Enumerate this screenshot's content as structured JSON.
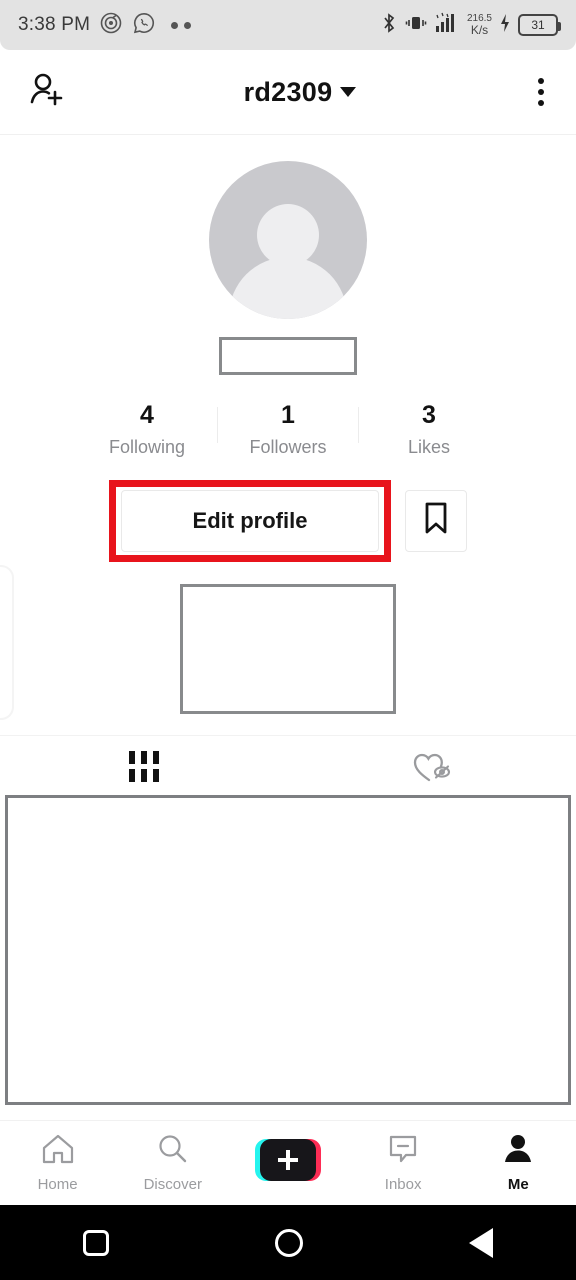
{
  "status_bar": {
    "time": "3:38 PM",
    "app_icons": [
      "music-app-icon",
      "whatsapp-icon",
      "more-notifications-dots"
    ],
    "bluetooth_icon": "bluetooth-icon",
    "vibrate_icon": "vibrate-icon",
    "signal_icon": "signal-bars-icon",
    "network_speed_value": "216.5",
    "network_speed_unit": "K/s",
    "charging_icon": "charging-bolt-icon",
    "battery_level": "31"
  },
  "header": {
    "add_friend_icon": "add-friend-icon",
    "username": "rd2309",
    "dropdown_icon": "chevron-down-icon",
    "menu_icon": "kebab-menu-icon"
  },
  "profile": {
    "avatar_icon": "default-avatar-icon",
    "username_redacted": "",
    "bio_redacted": "",
    "stats": [
      {
        "count": "4",
        "label": "Following"
      },
      {
        "count": "1",
        "label": "Followers"
      },
      {
        "count": "3",
        "label": "Likes"
      }
    ],
    "edit_profile_label": "Edit profile",
    "bookmark_icon": "bookmark-icon",
    "highlight_color": "#e8141c"
  },
  "tabs": [
    {
      "icon": "grid-posts-icon",
      "active": true
    },
    {
      "icon": "private-likes-heart-icon",
      "active": false
    }
  ],
  "content": {
    "grid_redacted": ""
  },
  "bottom_nav": {
    "items": [
      {
        "label": "Home",
        "icon": "home-icon",
        "active": false
      },
      {
        "label": "Discover",
        "icon": "search-icon",
        "active": false
      },
      {
        "label": "",
        "icon": "create-plus-icon",
        "active": false
      },
      {
        "label": "Inbox",
        "icon": "inbox-icon",
        "active": false
      },
      {
        "label": "Me",
        "icon": "person-icon",
        "active": true
      }
    ],
    "create_colors": {
      "cyan": "#25f4ee",
      "pink": "#fe2c55",
      "core": "#17161a"
    }
  },
  "android_nav": {
    "recents_icon": "recents-square-icon",
    "home_icon": "home-circle-icon",
    "back_icon": "back-triangle-icon"
  }
}
